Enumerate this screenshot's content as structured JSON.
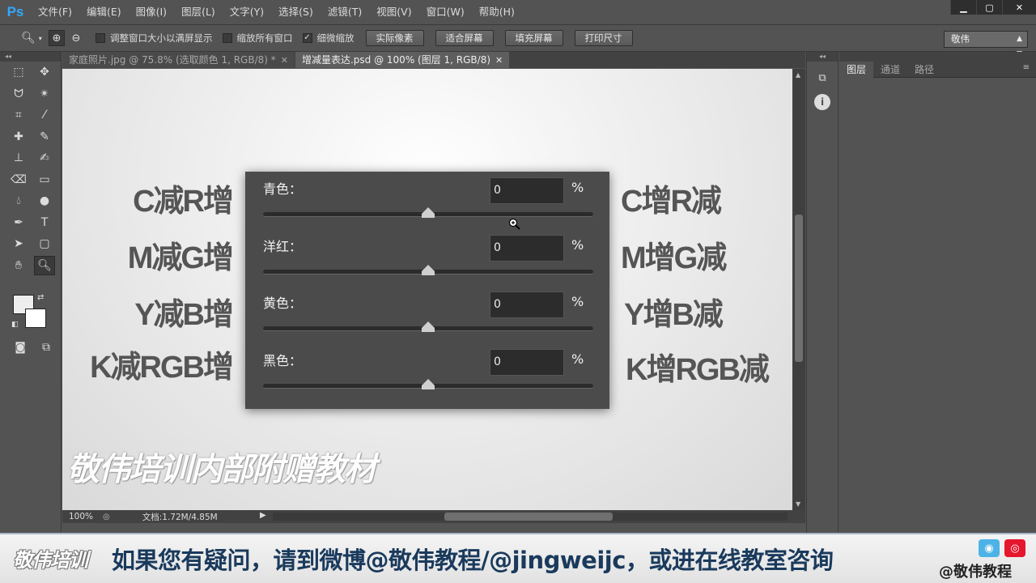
{
  "app": {
    "logo": "Ps",
    "menu": [
      "文件(F)",
      "编辑(E)",
      "图像(I)",
      "图层(L)",
      "文字(Y)",
      "选择(S)",
      "滤镜(T)",
      "视图(V)",
      "窗口(W)",
      "帮助(H)"
    ],
    "window_controls": {
      "minimize": "▁",
      "restore": "▢",
      "close": "✕"
    }
  },
  "options_bar": {
    "checkboxes": [
      {
        "label": "调整窗口大小以满屏显示",
        "checked": false
      },
      {
        "label": "缩放所有窗口",
        "checked": false
      },
      {
        "label": "细微缩放",
        "checked": true
      }
    ],
    "buttons": [
      "实际像素",
      "适合屏幕",
      "填充屏幕",
      "打印尺寸"
    ],
    "workspace": "敬伟"
  },
  "tabs": [
    {
      "label": "家庭照片.jpg @ 75.8% (选取颜色 1, RGB/8) *",
      "active": false
    },
    {
      "label": "增减量表达.psd @ 100% (图层 1, RGB/8)",
      "active": true
    }
  ],
  "canvas": {
    "left_labels": [
      "C减R增",
      "M减G增",
      "Y减B增",
      "K减RGB增"
    ],
    "right_labels": [
      "C增R减",
      "M增G减",
      "Y增B减",
      "K增RGB减"
    ],
    "sliders": [
      {
        "label": "青色：",
        "value": "0",
        "unit": "%",
        "position": 0.5
      },
      {
        "label": "洋红：",
        "value": "0",
        "unit": "%",
        "position": 0.5
      },
      {
        "label": "黄色：",
        "value": "0",
        "unit": "%",
        "position": 0.5
      },
      {
        "label": "黑色：",
        "value": "0",
        "unit": "%",
        "position": 0.5
      }
    ],
    "watermark": "敬伟培训内部附赠教材"
  },
  "status": {
    "zoom": "100%",
    "doc_info": "文档:1.72M/4.85M"
  },
  "layers_panel": {
    "tabs": [
      "图层",
      "通道",
      "路径"
    ],
    "active_tab": "图层"
  },
  "banner": {
    "logo": "敬伟培训",
    "text": "如果您有疑问，请到微博@敬伟教程/@jingweijc，或进在线教室咨询",
    "weibo": "@敬伟教程"
  },
  "colors": {
    "ps_blue": "#31a8ff",
    "banner_text": "#1a3a5c"
  }
}
